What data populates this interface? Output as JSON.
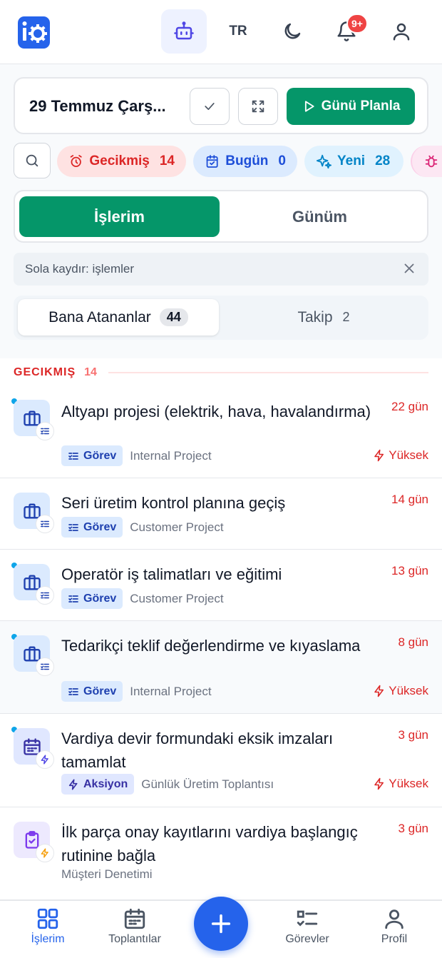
{
  "header": {
    "lang": "TR",
    "notifications_badge": "9+"
  },
  "toolbar": {
    "date": "29 Temmuz Çarş...",
    "plan_label": "Günü Planla"
  },
  "chips": [
    {
      "label": "Gecikmiş",
      "count": "14"
    },
    {
      "label": "Bugün",
      "count": "0"
    },
    {
      "label": "Yeni",
      "count": "28"
    }
  ],
  "segment": {
    "active": "İşlerim",
    "inactive": "Günüm"
  },
  "hint": "Sola kaydır: işlemler",
  "subtabs": [
    {
      "label": "Bana Atananlar",
      "count": "44"
    },
    {
      "label": "Takip",
      "count": "2"
    }
  ],
  "section": {
    "title": "GECIKMIŞ",
    "count": "14"
  },
  "items": [
    {
      "title": "Altyapı projesi (elektrik, hava, havalandırma)",
      "days": "22 gün",
      "tag": "Görev",
      "project": "Internal Project",
      "priority": "Yüksek"
    },
    {
      "title": "Seri üretim kontrol planına geçiş",
      "days": "14 gün",
      "tag": "Görev",
      "project": "Customer Project",
      "priority": ""
    },
    {
      "title": "Operatör iş talimatları ve eğitimi",
      "days": "13 gün",
      "tag": "Görev",
      "project": "Customer Project",
      "priority": ""
    },
    {
      "title": "Tedarikçi teklif değerlendirme ve kıyaslama",
      "days": "8 gün",
      "tag": "Görev",
      "project": "Internal Project",
      "priority": "Yüksek"
    },
    {
      "title": "Vardiya devir formundaki eksik imzaları tamamlat",
      "days": "3 gün",
      "tag": "Aksiyon",
      "project": "Günlük Üretim Toplantısı",
      "priority": "Yüksek"
    },
    {
      "title": "İlk parça onay kayıtlarını vardiya başlangıç rutinine bağla",
      "days": "3 gün",
      "tag": "",
      "project": "Müşteri Denetimi",
      "priority": ""
    }
  ],
  "nav": [
    {
      "label": "İşlerim"
    },
    {
      "label": "Toplantılar"
    },
    {
      "label": "Görevler"
    },
    {
      "label": "Profil"
    }
  ],
  "colors": {
    "primary": "#2563eb",
    "success": "#059669",
    "danger": "#dc2626"
  }
}
